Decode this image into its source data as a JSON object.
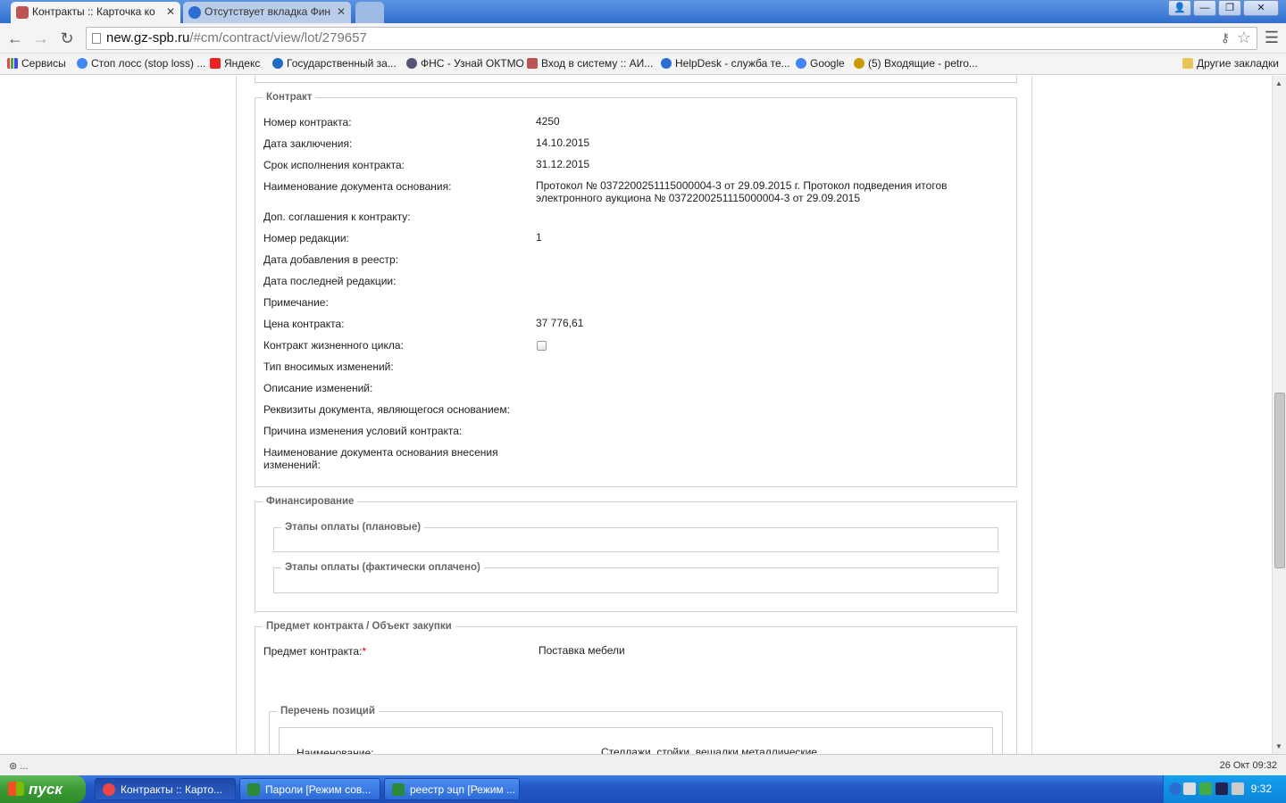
{
  "browser": {
    "tabs": [
      {
        "title": "Контракты :: Карточка ко",
        "active": true
      },
      {
        "title": "Отсутствует вкладка Фин",
        "active": false
      }
    ],
    "url_host": "new.gz-spb.ru",
    "url_path": "/#cm/contract/view/lot/279657",
    "bookmarks": [
      "Сервисы",
      "Стоп лосс (stop loss) ...",
      "Яндекс",
      "Государственный за...",
      "ФНС - Узнай ОКТМО",
      "Вход в систему :: АИ...",
      "HelpDesk - служба те...",
      "Google",
      "(5) Входящие - petro..."
    ],
    "other_bookmarks": "Другие закладки"
  },
  "contract": {
    "legend": "Контракт",
    "rows": [
      {
        "label": "Номер контракта:",
        "value": "4250"
      },
      {
        "label": "Дата заключения:",
        "value": "14.10.2015"
      },
      {
        "label": "Срок исполнения контракта:",
        "value": "31.12.2015"
      },
      {
        "label": "Наименование документа основания:",
        "value": "Протокол № 0372200251115000004-3 от 29.09.2015 г. Протокол подведения итогов электронного аукциона № 0372200251115000004-3 от 29.09.2015"
      },
      {
        "label": "Доп. соглашения к контракту:",
        "value": ""
      },
      {
        "label": "Номер редакции:",
        "value": "1"
      },
      {
        "label": "Дата добавления в реестр:",
        "value": ""
      },
      {
        "label": "Дата последней редакции:",
        "value": ""
      },
      {
        "label": "Примечание:",
        "value": ""
      },
      {
        "label": "Цена контракта:",
        "value": "37 776,61"
      },
      {
        "label": "Контракт жизненного цикла:",
        "value": ""
      },
      {
        "label": "Тип вносимых изменений:",
        "value": ""
      },
      {
        "label": "Описание изменений:",
        "value": ""
      },
      {
        "label": "Реквизиты документа, являющегося основанием:",
        "value": ""
      },
      {
        "label": "Причина изменения условий контракта:",
        "value": ""
      },
      {
        "label": "Наименование документа основания внесения изменений:",
        "value": ""
      }
    ],
    "life_cycle_checked": false
  },
  "financing": {
    "legend": "Финансирование",
    "planned": "Этапы оплаты (плановые)",
    "actual": "Этапы оплаты (фактически оплачено)"
  },
  "subject": {
    "legend": "Предмет контракта / Объект закупки",
    "label": "Предмет контракта:",
    "required_mark": "*",
    "value": "Поставка мебели",
    "positions_legend": "Перечень позиций",
    "item_label": "Наименование:",
    "item_value": "Стеллажи, стойки, вешалки металлические"
  },
  "status": {
    "left": "...",
    "right": "26 Окт 09:32"
  },
  "taskbar": {
    "start": "пуск",
    "tasks": [
      "Контракты :: Карто...",
      "Пароли  [Режим сов...",
      "реестр эцп  [Режим ..."
    ],
    "clock": "9:32"
  }
}
